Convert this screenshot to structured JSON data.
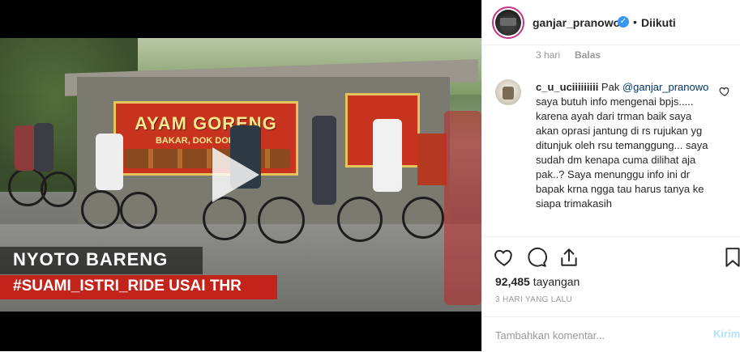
{
  "video": {
    "sign_main_title": "AYAM GORENG",
    "sign_main_sub": "BAKAR, DOK DOK DER",
    "caption_line1": "NYOTO BARENG",
    "caption_line2": "#SUAMI_ISTRI_RIDE USAI THR"
  },
  "header": {
    "username": "ganjar_pranowo",
    "verified_icon": "✓",
    "separator": "•",
    "follow_status": "Diikuti"
  },
  "previous_comment_meta": {
    "time": "3 hari",
    "reply_label": "Balas"
  },
  "comment": {
    "username": "c_u_uciiiiiiiii",
    "text_before_mention": " Pak ",
    "mention": "@ganjar_pranowo",
    "text_after_mention": " saya butuh info mengenai bpjs..... karena ayah dari trman baik saya akan oprasi jantung di rs rujukan yg ditunjuk oleh rsu temanggung... saya sudah dm kenapa cuma dilihat aja pak..? Saya menunggu info ini dr bapak krna ngga tau harus tanya ke siapa trimakasih"
  },
  "stats": {
    "views_count": "92,485",
    "views_label": "tayangan",
    "date": "3 HARI YANG LALU"
  },
  "add_comment": {
    "placeholder": "Tambahkan komentar...",
    "post_label": "Kirim"
  },
  "colors": {
    "verified": "#3897f0",
    "caption_red": "#c2241c",
    "post_button": "#b2dffc",
    "meta_gray": "#999999"
  }
}
